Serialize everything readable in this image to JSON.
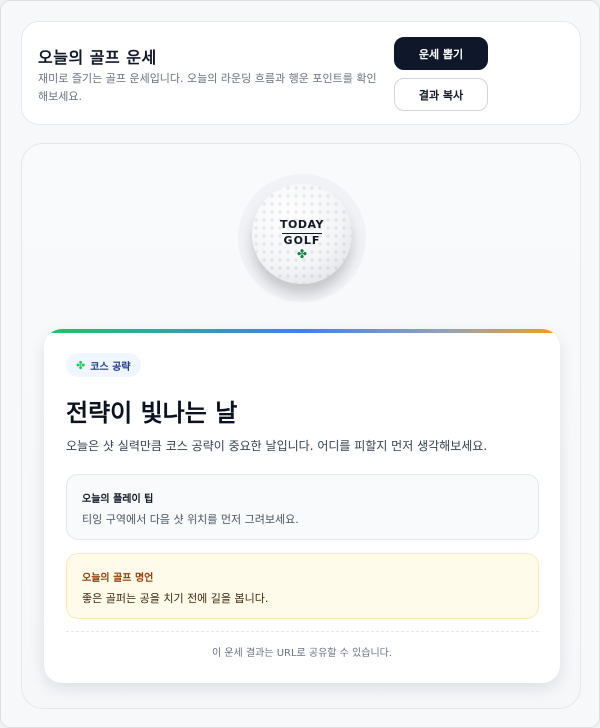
{
  "header": {
    "title": "오늘의 골프 운세",
    "description": "재미로 즐기는 골프 운세입니다. 오늘의 라운딩 흐름과 행운 포인트를 확인해보세요.",
    "draw_button": "운세 뽑기",
    "copy_button": "결과 복사"
  },
  "ball": {
    "line1": "TODAY",
    "line2": "GOLF",
    "icon": "clover-icon"
  },
  "result": {
    "badge": "코스 공략",
    "badge_icon": "clover-icon",
    "title": "전략이 빛나는 날",
    "description": "오늘은 샷 실력만큼 코스 공략이 중요한 날입니다. 어디를 피할지 먼저 생각해보세요.",
    "tip_label": "오늘의 플레이 팁",
    "tip_text": "티잉 구역에서 다음 샷 위치를 먼저 그려보세요.",
    "quote_label": "오늘의 골프 명언",
    "quote_text": "좋은 골퍼는 공을 치기 전에 길을 봅니다.",
    "footer": "이 운세 결과는 URL로 공유할 수 있습니다."
  },
  "colors": {
    "primary": "#0f172a",
    "accent_gradient": [
      "#22c55e",
      "#3b82f6",
      "#94a3b8",
      "#f59e0b"
    ],
    "quote_bg": "#fffbeb"
  }
}
